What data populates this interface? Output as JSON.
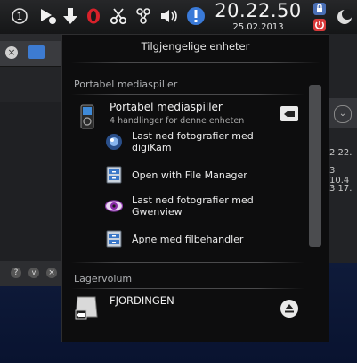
{
  "clock": {
    "time": "20.22.50",
    "date": "25.02.2013"
  },
  "popup": {
    "title": "Tilgjengelige enheter",
    "sections": [
      {
        "heading": "Portabel mediaspiller",
        "device": {
          "name": "Portabel mediaspiller",
          "subtitle": "4 handlinger for denne enheten",
          "icon": "media-player-icon",
          "actions": [
            {
              "label": "Last ned fotografier med digiKam",
              "icon": "digikam-icon"
            },
            {
              "label": "Open with File Manager",
              "icon": "file-manager-icon"
            },
            {
              "label": "Last ned fotografier med Gwenview",
              "icon": "gwenview-icon"
            },
            {
              "label": "Åpne med filbehandler",
              "icon": "file-manager-icon"
            }
          ]
        }
      },
      {
        "heading": "Lagervolum",
        "device": {
          "name": "FJORDINGEN",
          "icon": "drive-icon"
        }
      }
    ]
  },
  "background": {
    "right_rows": [
      "2 22.",
      "3 10.4",
      "3 17."
    ]
  },
  "colors": {
    "accent": "#3a7ad8",
    "alert": "#d93a3a"
  }
}
